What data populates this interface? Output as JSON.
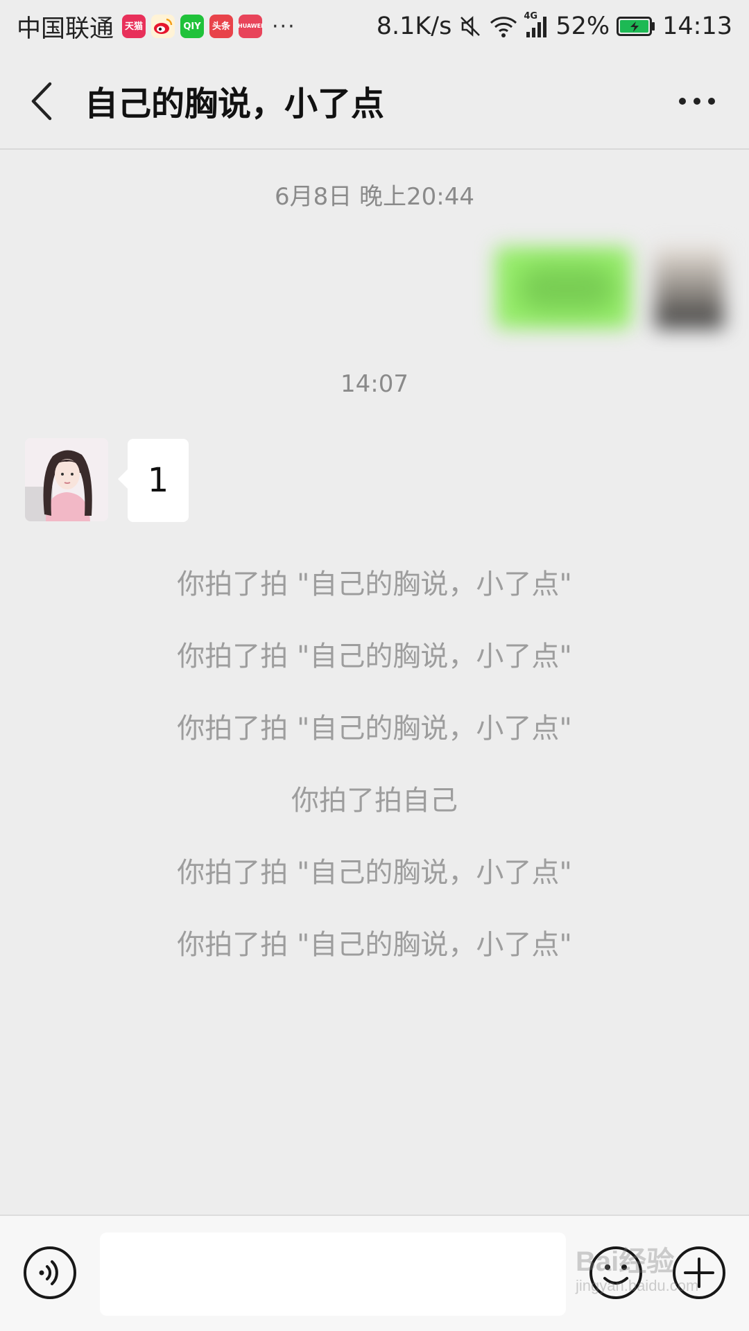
{
  "status_bar": {
    "carrier": "中国联通",
    "app_icons": [
      {
        "name": "tmall-icon",
        "label": "天猫",
        "color": "#e8305a"
      },
      {
        "name": "weibo-icon",
        "label": "",
        "color": "#f3c245"
      },
      {
        "name": "iqiyi-icon",
        "label": "QIY",
        "color": "#20c23a"
      },
      {
        "name": "toutiao-icon",
        "label": "头条",
        "color": "#e8434a"
      },
      {
        "name": "huawei-store-icon",
        "label": "HUAWEI",
        "color": "#e8445a"
      }
    ],
    "more_dots": "···",
    "network_speed": "8.1K/s",
    "signal_type": "4G",
    "battery": "52%",
    "time": "14:13"
  },
  "header": {
    "title": "自己的胸说，小了点"
  },
  "chat": {
    "timestamp_1": "6月8日 晚上20:44",
    "timestamp_2": "14:07",
    "incoming_message": "1",
    "system_messages": [
      "你拍了拍 \"自己的胸说，小了点\"",
      "你拍了拍 \"自己的胸说，小了点\"",
      "你拍了拍 \"自己的胸说，小了点\"",
      "你拍了拍自己",
      "你拍了拍 \"自己的胸说，小了点\"",
      "你拍了拍 \"自己的胸说，小了点\""
    ]
  },
  "input_bar": {
    "value": "",
    "placeholder": ""
  },
  "watermark": {
    "brand": "Bai经验",
    "url": "jingyan.baidu.com"
  },
  "colors": {
    "background": "#ededed",
    "outgoing_bubble": "#95ec69",
    "incoming_bubble": "#ffffff",
    "system_text": "#9d9d9d",
    "battery_fill": "#1db954"
  }
}
